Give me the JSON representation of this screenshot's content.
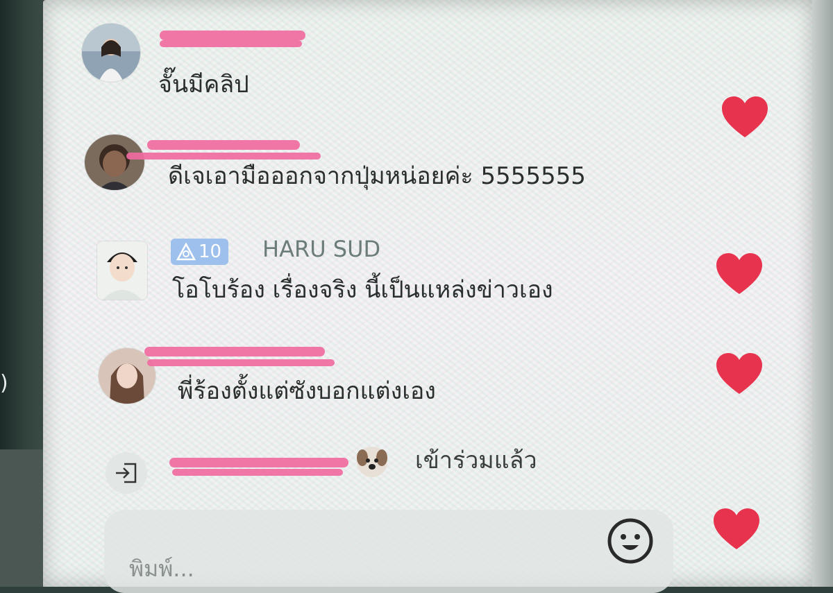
{
  "comments": [
    {
      "text": "จั๊นมีคลิป",
      "avatar": "avatar-photo-woman",
      "liked": false
    },
    {
      "text": "ดีเจเอามือออกจากปุ่มหน่อยค่ะ 5555555",
      "avatar": "avatar-photo-man",
      "liked": true
    },
    {
      "name": "HARU SUD",
      "badge": "10",
      "badge_icon": "triangle-icon",
      "text": "โอโบร้อง เรื่องจริง นี้เป็นแหล่งข่าวเอง",
      "avatar": "avatar-photo-cartoon",
      "liked": true
    },
    {
      "text": "พี่ร้องตั้งแต่ซังบอกแต่งเอง",
      "avatar": "avatar-photo-woman-2",
      "liked": true
    }
  ],
  "join_event": {
    "text": "เข้าร่วมแล้ว",
    "icon": "join-arrow-icon",
    "emoji": "dog-emoji"
  },
  "input": {
    "placeholder": "พิมพ์..."
  },
  "icons": {
    "heart": "heart-icon",
    "emoji_button": "smiley-icon"
  },
  "colors": {
    "heart": "#e8334f",
    "redaction": "#f06b9f",
    "badge": "#9ec0ec",
    "name": "#6c7c78"
  }
}
